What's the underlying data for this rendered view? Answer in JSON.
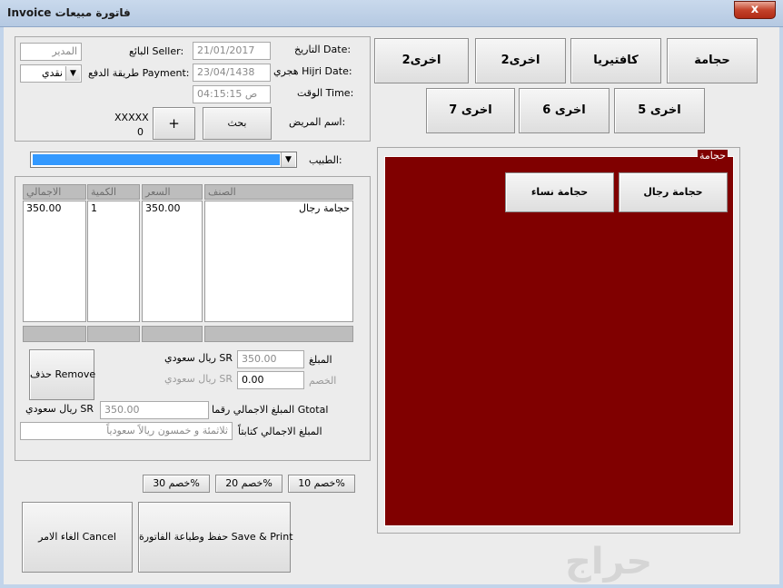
{
  "window": {
    "title": "Invoice فاتورة مبيعات",
    "close_symbol": "x"
  },
  "header": {
    "date_label": "التاريخ Date:",
    "date_value": "21/01/2017",
    "hijri_label": "هجري Hijri Date:",
    "hijri_value": "23/04/1438",
    "time_label": "الوقت Time:",
    "time_value": "ص 04:15:15",
    "patient_label": "اسم المريض:",
    "seller_label": "البائع Seller:",
    "seller_value": "المدير",
    "payment_label": "طريقة الدفع Payment:",
    "payment_value": "نقدي",
    "search_button": "بحث",
    "add_button": "+",
    "patient_code": "XXXXX",
    "patient_count": "0"
  },
  "doctor": {
    "label": "الطبيب:",
    "value": ""
  },
  "items_table": {
    "columns": [
      "الصنف",
      "السعر",
      "الكمية",
      "الاجمالي"
    ],
    "rows": [
      {
        "item": "حجامة رجال",
        "price": "350.00",
        "qty": "1",
        "total": "350.00"
      }
    ]
  },
  "totals": {
    "amount_label": "المبلغ",
    "amount_value": "350.00",
    "amount_currency": "ريال سعودي SR",
    "discount_label": "الخصم",
    "discount_value": "0.00",
    "discount_currency": "ريال سعودي SR",
    "remove_button": "حذف Remove",
    "gtotal_label": "المبلغ الاجمالي رقما Gtotal",
    "gtotal_value": "350.00",
    "gtotal_currency": "ريال سعودي SR",
    "words_label": "المبلغ الاجمالي كتابتاً",
    "words_value": "ثلاثمئة و خمسون ريالاً سعودياً"
  },
  "discount_buttons": [
    "خصم 10%",
    "خصم 20%",
    "خصم 30%"
  ],
  "actions": {
    "save_print": "حفظ وطباعة الفاتورة Save & Print",
    "cancel": "الغاء الامر Cancel"
  },
  "categories": {
    "row1": [
      "حجامة",
      "كافتيريا",
      "اخرى2",
      "اخرى2"
    ],
    "row2": [
      "اخرى 5",
      "اخرى 6",
      "اخرى 7"
    ]
  },
  "products_panel": {
    "title": "حجامة",
    "items": [
      "حجامة رجال",
      "حجامة نساء"
    ],
    "background": "#800000"
  },
  "watermark": "حراج"
}
